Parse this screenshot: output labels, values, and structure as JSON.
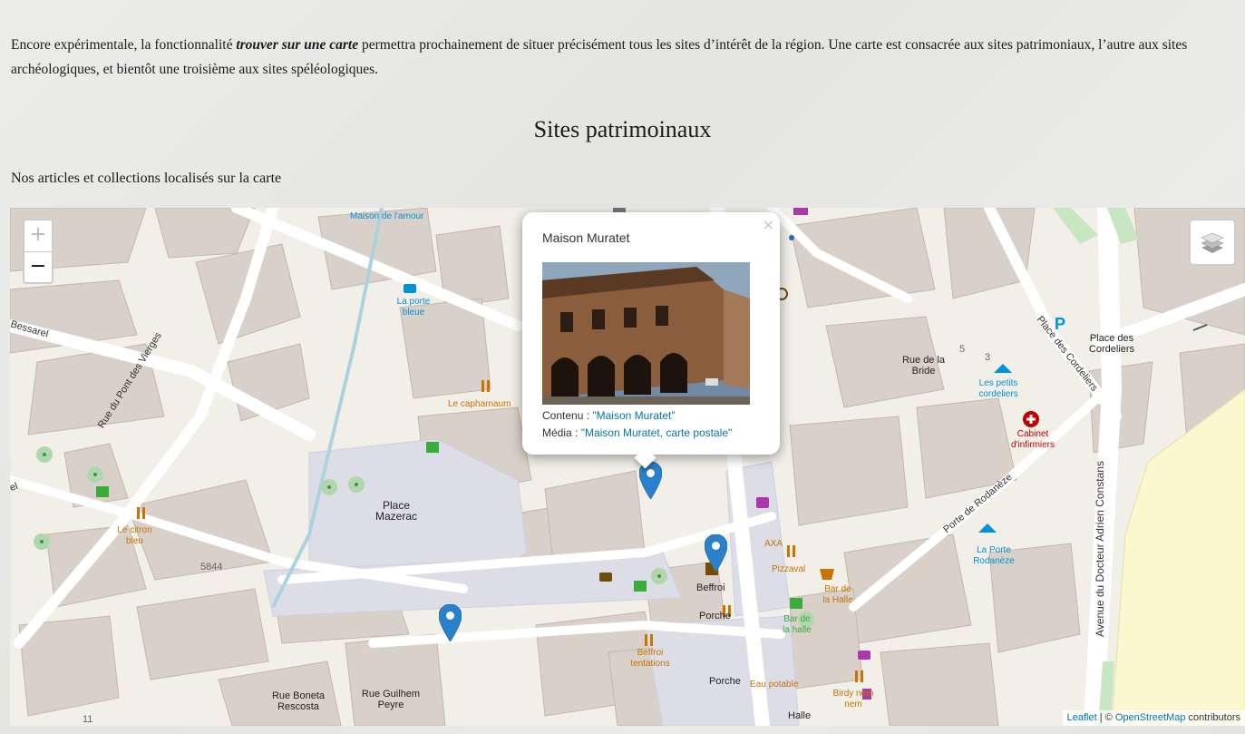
{
  "intro": {
    "before": "Encore expérimentale, la fonctionnalité ",
    "emphasis": "trouver sur une carte",
    "after": " permettra prochainement de situer précisément tous les sites d’intérêt de la région. Une carte est consacrée aux sites patrimoniaux, l’autre aux sites archéologiques, et bientôt une troisième aux sites spéléologiques."
  },
  "section_title": "Sites patrimoinaux",
  "subtitle": "Nos articles et collections localisés sur la carte",
  "map": {
    "zoom_in": "+",
    "zoom_out": "−",
    "layers_icon": "layers-icon",
    "attribution": {
      "leaflet": "Leaflet",
      "separator": " | © ",
      "osm": "OpenStreetMap",
      "contributors": " contributors"
    },
    "colors": {
      "marker": "#2a81cb",
      "link": "#0078a8",
      "poi_orange": "#c77400",
      "poi_blue": "#0092da"
    },
    "popup": {
      "title": "Maison Muratet",
      "close": "×",
      "content_label": "Contenu : ",
      "content_link": "\"Maison Muratet\"",
      "media_label": "Média : ",
      "media_link": "\"Maison Muratet, carte postale\""
    },
    "labels": {
      "maison_amour": "Maison de l'amour",
      "porte_bleue": "La porte bleue",
      "bessarel": "Bessarel",
      "pont_vierges": "Rue du Pont des Vierges",
      "capharnaum": "Le capharnaum",
      "place_mazerac": "Place Mazerac",
      "citron": "Le citron bleu",
      "n5844": "5844",
      "rue_bride": "Rue de la Bride",
      "n5": "5",
      "n3": "3",
      "petits_cordeliers": "Les petits cordeliers",
      "place_cordeliers_street": "Place des Cordeliers",
      "place_cordeliers": "Place des Cordeliers",
      "cabinet": "Cabinet d'infirmiers",
      "porte_rodaneze_street": "Porte de Rodanèze",
      "la_porte_rodaneze": "La Porte Rodanèze",
      "avenue": "Avenue du Docteur Adrien Constans",
      "axa": "AXA",
      "pizzaval": "Pizzaval",
      "bar_halle_orange": "Bar de la Halle",
      "bar_halle_green": "Bar de la halle",
      "beffroi": "Beffroi",
      "porche": "Porche",
      "porche2": "Porche",
      "beffroi_tentations": "Beffroi tentations",
      "eau_potable": "Eau potable",
      "birdy": "Birdy nem nem",
      "halle": "Halle",
      "rue_boneta": "Rue Boneta Rescosta",
      "rue_guilhem": "Rue Guilhem Peyre",
      "n11": "11",
      "el": "el"
    }
  }
}
